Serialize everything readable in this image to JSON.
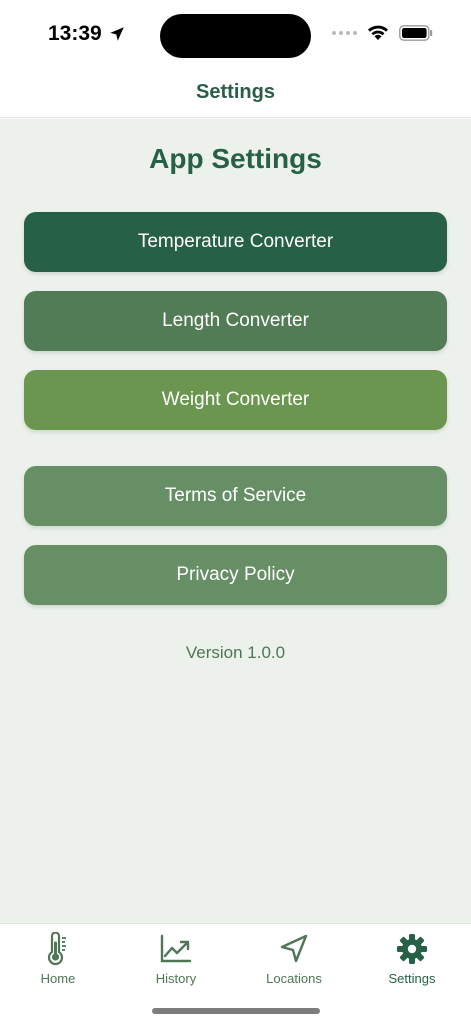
{
  "status_bar": {
    "time": "13:39",
    "icons": [
      "location-arrow-icon",
      "cellular-dots-icon",
      "wifi-icon",
      "battery-icon"
    ]
  },
  "header": {
    "title": "Settings"
  },
  "main": {
    "title": "App Settings",
    "buttons": [
      {
        "label": "Temperature Converter",
        "color": "#266046"
      },
      {
        "label": "Length Converter",
        "color": "#527c55"
      },
      {
        "label": "Weight Converter",
        "color": "#6a964f"
      },
      {
        "label": "Terms of Service",
        "color": "#678f66"
      },
      {
        "label": "Privacy Policy",
        "color": "#678f66"
      }
    ],
    "version": "Version 1.0.0"
  },
  "tab_bar": {
    "tabs": [
      {
        "label": "Home",
        "icon": "thermometer-icon"
      },
      {
        "label": "History",
        "icon": "chart-trend-icon"
      },
      {
        "label": "Locations",
        "icon": "navigation-arrow-icon"
      },
      {
        "label": "Settings",
        "icon": "gear-icon",
        "active": true
      }
    ]
  },
  "colors": {
    "accent": "#266046",
    "background": "#ecf1eb",
    "muted": "#4f7656"
  }
}
